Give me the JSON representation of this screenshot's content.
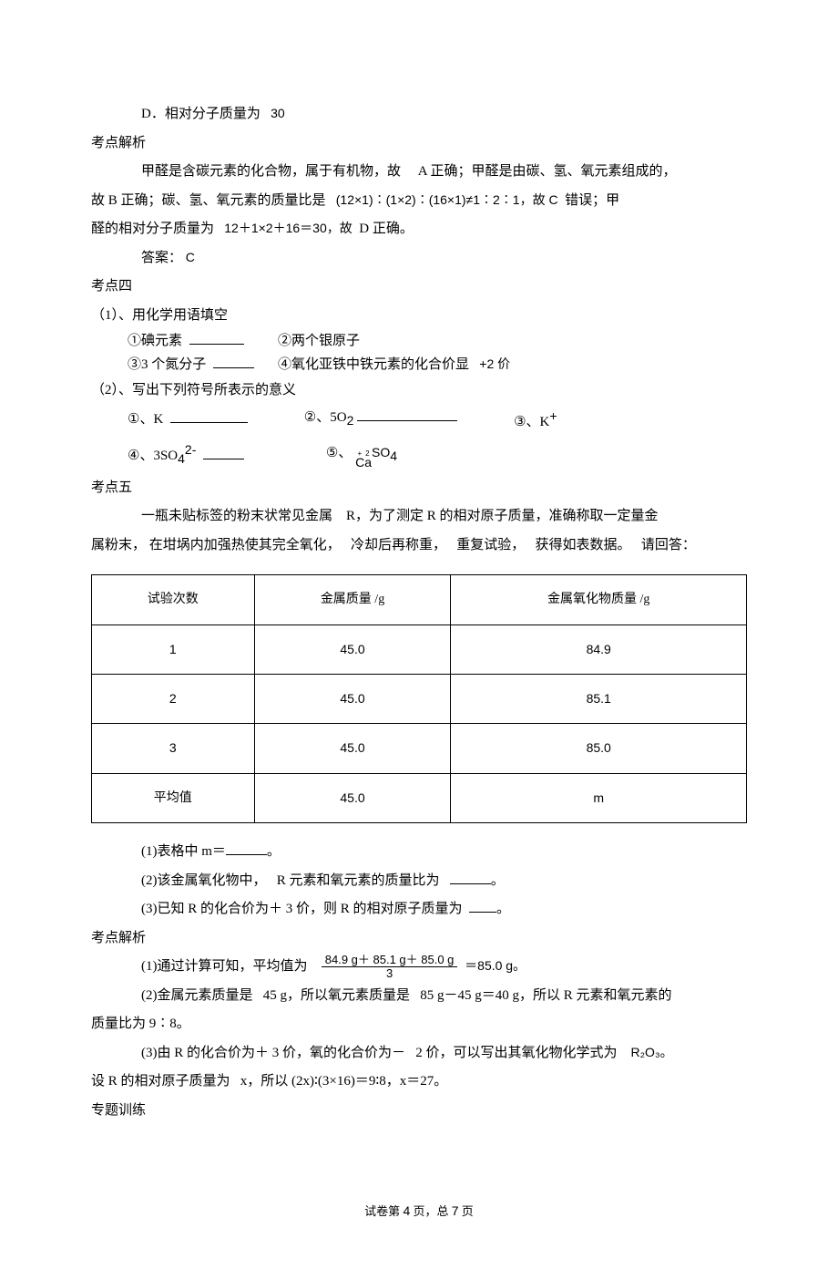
{
  "d_option": "D．相对分子质量为",
  "d_value": "30",
  "kp_analysis": "考点解析",
  "analysis_para": "甲醛是含碳元素的化合物，属于有机物，故",
  "analysis_a": "A 正确；甲醛是由碳、氢、氧元素组成的，",
  "analysis_b_prefix": "故 B 正确；碳、氢、氧元素的质量比是",
  "analysis_ratio": "(12×1)∶(1×2)∶(16×1)≠1∶2∶1，故 C",
  "analysis_c_suffix": "错误；甲",
  "analysis_d_line": "醛的相对分子质量为",
  "analysis_calc": "12＋1×2＋16＝30，故",
  "analysis_d_end": "D 正确。",
  "answer_label": "答案：",
  "answer_value": "C",
  "kp4": "考点四",
  "kp4_1": "（1）、用化学用语填空",
  "kp4_1_1": "①碘元素",
  "kp4_1_2": "②两个银原子",
  "kp4_1_3": "③3 个氮分子",
  "kp4_1_4": "④氧化亚铁中铁元素的化合价显",
  "kp4_1_4_val": "+2 价",
  "kp4_2": "（2）、写出下列符号所表示的意义",
  "kp4_2_1_label": "①、K",
  "kp4_2_2_label": "②、5O",
  "kp4_2_2_sub": "2",
  "kp4_2_3_label": "③、K",
  "kp4_2_3_sup": "+",
  "kp4_2_4_label": "④、3SO",
  "kp4_2_4_sub": "4",
  "kp4_2_4_sup": "2-",
  "kp4_2_5_label": "⑤、",
  "kp4_2_5_anno1": "+",
  "kp4_2_5_anno2": "2",
  "kp4_2_5_ca": "Ca",
  "kp4_2_5_rest": "SO",
  "kp4_2_5_sub": "4",
  "kp5": "考点五",
  "kp5_p1_a": "一瓶未贴标签的粉末状常见金属",
  "kp5_p1_b": "R，为了测定 R 的相对原子质量，准确称取一定量金",
  "kp5_p2_a": "属粉末，  在坩埚内加强热使其完全氧化，",
  "kp5_p2_b": "冷却后再称重，",
  "kp5_p2_c": "重复试验，",
  "kp5_p2_d": "获得如表数据。",
  "kp5_p2_e": "请回答：",
  "table": {
    "h1": "试验次数",
    "h2": "金属质量  /g",
    "h3": "金属氧化物质量  /g",
    "rows": [
      {
        "n": "1",
        "m": "45.0",
        "ox": "84.9"
      },
      {
        "n": "2",
        "m": "45.0",
        "ox": "85.1"
      },
      {
        "n": "3",
        "m": "45.0",
        "ox": "85.0"
      },
      {
        "n": "平均值",
        "m": "45.0",
        "ox": "m"
      }
    ]
  },
  "q1": "(1)表格中  m＝",
  "q1_end": "。",
  "q2_a": "(2)该金属氧化物中，",
  "q2_b": "R 元素和氧元素的质量比为",
  "q2_end": "。",
  "q3_a": "(3)已知  R 的化合价为＋ 3 价，则 R 的相对原子质量为",
  "q3_end": "。",
  "kp5_analysis": "考点解析",
  "ans1_prefix": "(1)通过计算可知，平均值为",
  "frac_num": "84.9 g＋ 85.1 g＋ 85.0 g",
  "frac_den": "3",
  "ans1_suffix": "＝85.0 g。",
  "ans2_a": "(2)金属元素质量是",
  "ans2_b": "45 g，所以氧元素质量是",
  "ans2_c": "85 g－45 g＝40 g，所以 R 元素和氧元素的",
  "ans2_d": "质量比为  9∶8。",
  "ans3_a": "(3)由 R 的化合价为＋ 3 价，氧的化合价为－",
  "ans3_b": "2 价，可以写出其氧化物化学式为",
  "ans3_c": "R₂O₃。",
  "ans3_d": "设 R 的相对原子质量为",
  "ans3_e": "x，所以 (2x)∶(3×16)＝9∶8，x＝27。",
  "special_training": "专题训练",
  "footer_a": "试卷第",
  "footer_page": "4",
  "footer_b": "页，总",
  "footer_total": "7",
  "footer_c": "页"
}
